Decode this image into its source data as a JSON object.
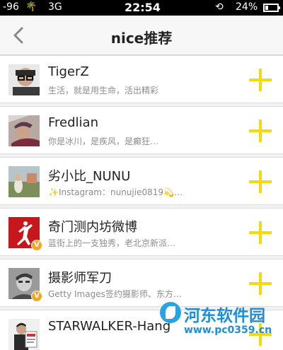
{
  "status_bar": {
    "signal": "-96",
    "network": "3G",
    "time": "22:54",
    "battery": "24%",
    "battery_level": 0.24,
    "icons": [
      "palm-tree-icon",
      "lock-rotation-icon",
      "battery-icon"
    ]
  },
  "nav": {
    "title": "nice推荐",
    "back_icon": "chevron-left-icon"
  },
  "colors": {
    "follow_plus": "#f5d90a",
    "verified_badge": "#f5a623",
    "watermark": "#1e8fd6"
  },
  "users": [
    {
      "name": "TigerZ",
      "desc": "生活，就是用生命，活出精彩",
      "verified": false,
      "avatar": "man-with-glasses-avatar"
    },
    {
      "name": "Fredlian",
      "desc": "你是冰川，是疾风，是癫狂…",
      "verified": false,
      "avatar": "man-in-cap-avatar"
    },
    {
      "name": "劣小比_NUNU",
      "desc": "✨Instagram：nunujie0819💫…",
      "verified": false,
      "avatar": "landscape-avatar"
    },
    {
      "name": "奇门测内坊微博",
      "desc": "蓝街上的一支独秀，老北京新派…",
      "verified": true,
      "verified_label": "V",
      "avatar": "jumpman-logo-avatar"
    },
    {
      "name": "摄影师军刀",
      "desc": "Getty Images签约摄影师、东方…",
      "verified": true,
      "verified_label": "V",
      "avatar": "portrait-avatar"
    },
    {
      "name": "STARWALKER-Hang",
      "desc": "",
      "verified": false,
      "avatar": "man-with-magazine-avatar"
    }
  ],
  "watermark": {
    "title": "河东软件园",
    "url": "www.pc0359.cn"
  }
}
